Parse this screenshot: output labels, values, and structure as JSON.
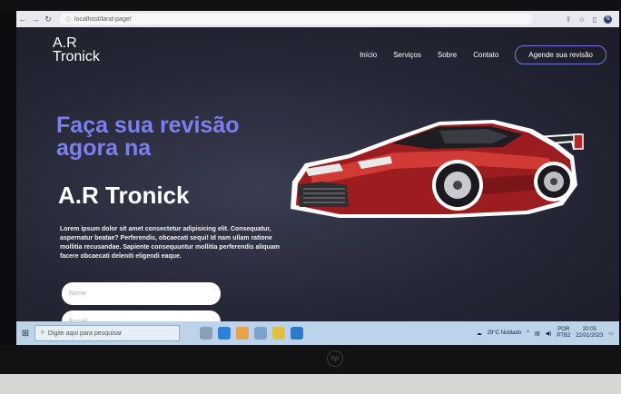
{
  "browser": {
    "url": "localhost/land-page/",
    "profile_initial": "N"
  },
  "site": {
    "brand_line1": "A.R",
    "brand_line2": "Tronick",
    "menu": [
      "Início",
      "Serviços",
      "Sobre",
      "Contato"
    ],
    "cta_label": "Agende sua revisão",
    "hero_title_line1": "Faça sua revisão",
    "hero_title_line2": "agora na",
    "hero_brand": "A.R Tronick",
    "hero_text": "Lorem ipsum dolor sit amet consectetur adipisicing elit. Consequatur, aspernatur beatae? Perferendis, obcaecati sequi! Id nam ullam ratione mollitia recusandae. Sapiente consequuntur mollitia perferendis aliquam facere obcaecati deleniti eligendi eaque.",
    "name_placeholder": "Nome",
    "email_placeholder": "E-mail"
  },
  "taskbar": {
    "search_placeholder": "Digite aqui para pesquisar",
    "weather": "29°C  Nublado",
    "lang_1": "POR",
    "lang_2": "PTB2",
    "time": "20:05",
    "date": "22/01/2023"
  },
  "colors": {
    "accent": "#7b7ff0",
    "background": "#2b2d3c",
    "taskbar": "#bcd3ea"
  }
}
